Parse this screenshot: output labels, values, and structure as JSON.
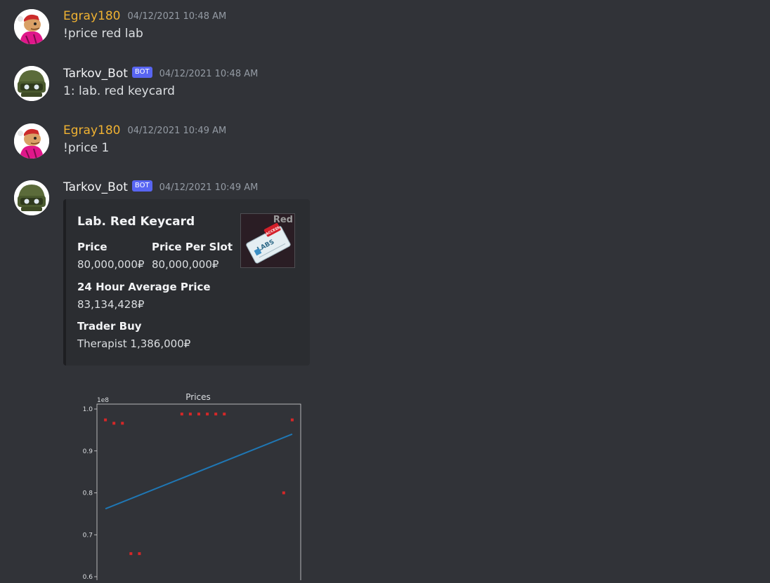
{
  "messages": [
    {
      "user": "Egray180",
      "timestamp": "04/12/2021 10:48 AM",
      "text": "!price red lab"
    },
    {
      "user": "Tarkov_Bot",
      "badge": "BOT",
      "timestamp": "04/12/2021 10:48 AM",
      "text": "1: lab. red keycard"
    },
    {
      "user": "Egray180",
      "timestamp": "04/12/2021 10:49 AM",
      "text": "!price 1"
    },
    {
      "user": "Tarkov_Bot",
      "badge": "BOT",
      "timestamp": "04/12/2021 10:49 AM"
    }
  ],
  "embed": {
    "title": "Lab. Red Keycard",
    "fields": [
      {
        "name": "Price",
        "value": "80,000,000₽"
      },
      {
        "name": "Price Per Slot",
        "value": "80,000,000₽"
      },
      {
        "name": "24 Hour Average Price",
        "value": "83,134,428₽"
      },
      {
        "name": "Trader Buy",
        "value": "Therapist 1,386,000₽"
      }
    ],
    "thumbnail": {
      "label": "Red",
      "icon": "keycard-icon",
      "card_text": "LABS",
      "stamp_text": "ACCESS"
    }
  },
  "colors": {
    "username_user": "#f0b232",
    "badge": "#5865f2",
    "background": "#313338"
  },
  "chart_data": {
    "type": "scatter",
    "title": "Prices",
    "offset_label": "1e8",
    "ylim": [
      0.6,
      1.0
    ],
    "yticks": [
      "0.6",
      "0.7",
      "0.8",
      "0.9",
      "1.0"
    ],
    "points": [
      {
        "x": 0,
        "y": 0.974
      },
      {
        "x": 1,
        "y": 0.966
      },
      {
        "x": 2,
        "y": 0.966
      },
      {
        "x": 3,
        "y": 0.655
      },
      {
        "x": 4,
        "y": 0.655
      },
      {
        "x": 9,
        "y": 0.988
      },
      {
        "x": 10,
        "y": 0.988
      },
      {
        "x": 11,
        "y": 0.988
      },
      {
        "x": 12,
        "y": 0.988
      },
      {
        "x": 13,
        "y": 0.988
      },
      {
        "x": 14,
        "y": 0.988
      },
      {
        "x": 21,
        "y": 0.8
      },
      {
        "x": 22,
        "y": 0.974
      }
    ],
    "trendline": {
      "start": {
        "x": 0,
        "y": 0.762
      },
      "end": {
        "x": 22,
        "y": 0.94
      }
    },
    "xlim": [
      -1,
      23
    ],
    "point_color": "#d62728",
    "line_color": "#1f77b4"
  }
}
